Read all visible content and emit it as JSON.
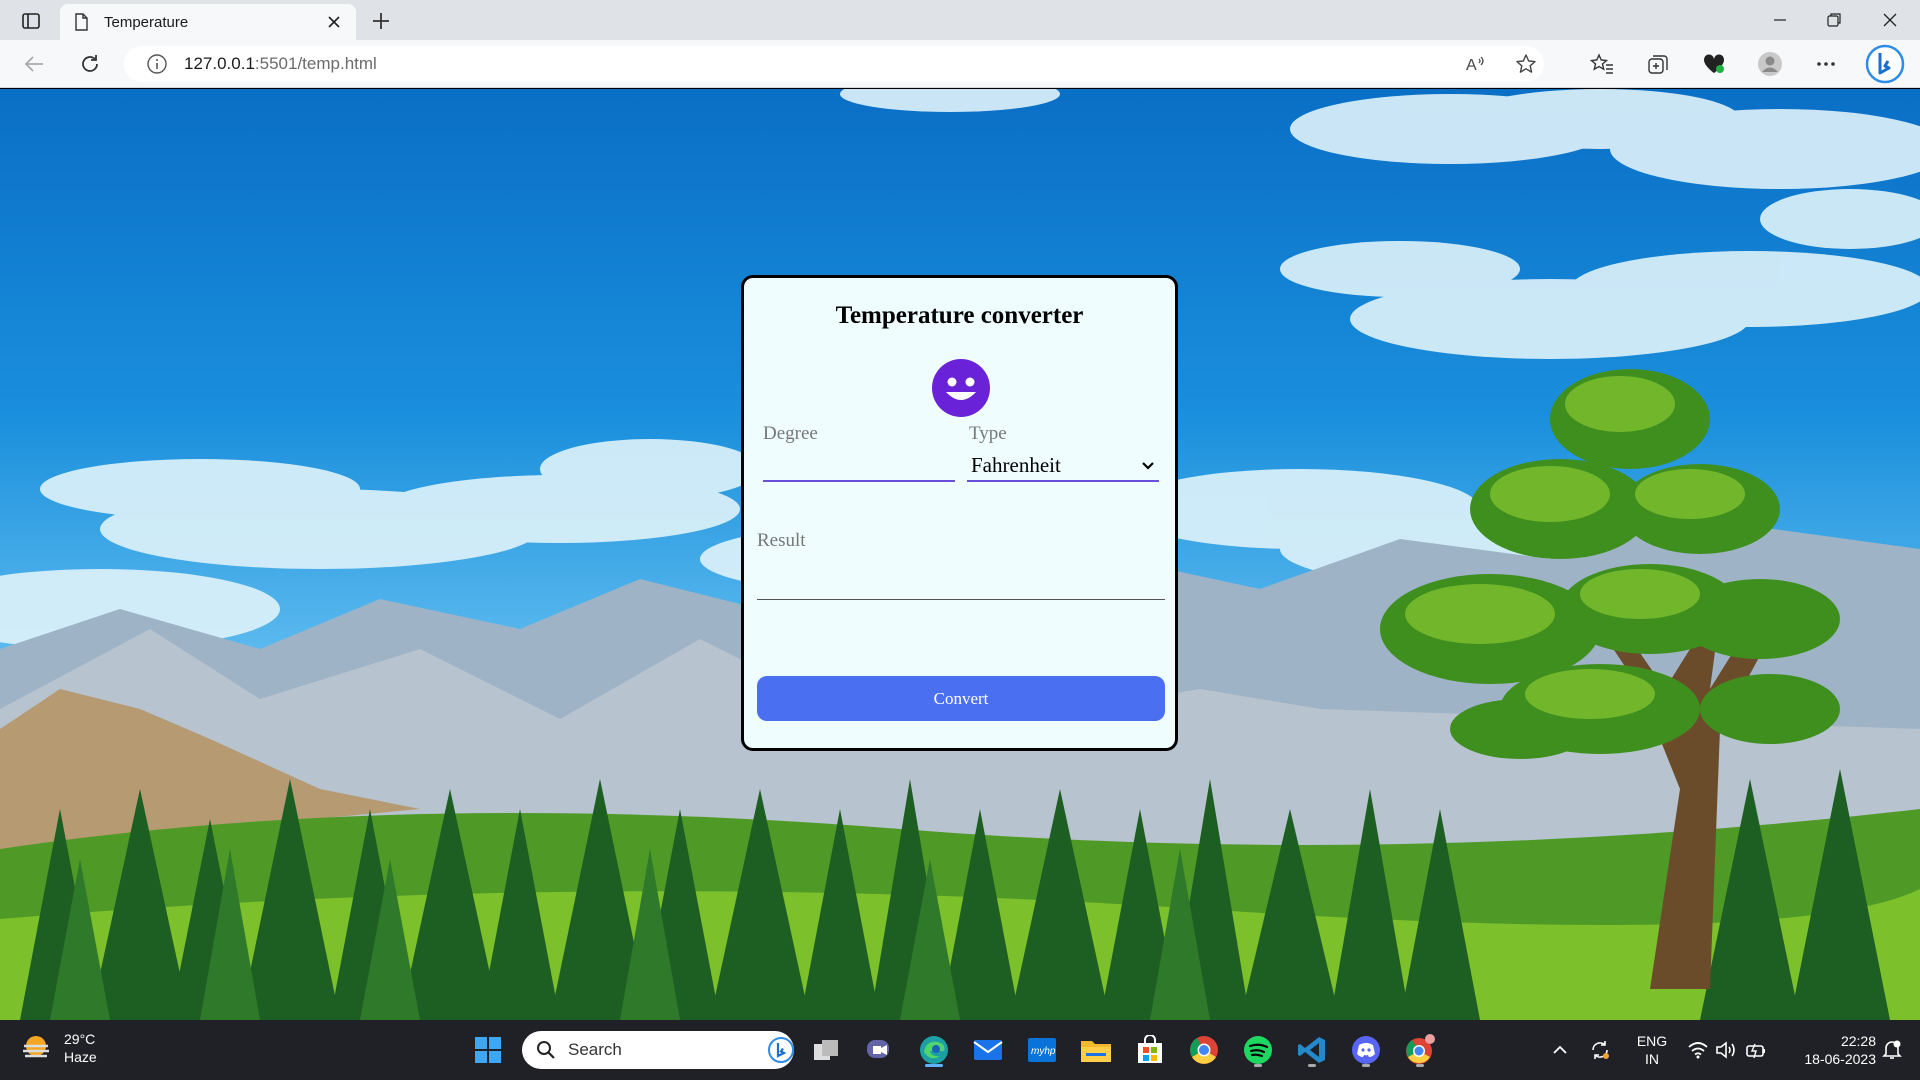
{
  "browser": {
    "tab_title": "Temperature",
    "url_host": "127.0.0.1",
    "url_path": ":5501/temp.html",
    "read_aloud_label": "Ȃ"
  },
  "card": {
    "title": "Temperature converter",
    "degree_label": "Degree",
    "degree_value": "",
    "type_label": "Type",
    "type_value": "Fahrenheit",
    "result_label": "Result",
    "result_value": "",
    "convert_label": "Convert",
    "accent": "#4a6ff0",
    "smiley_color": "#6a22d9"
  },
  "taskbar": {
    "weather_temp": "29°C",
    "weather_desc": "Haze",
    "search_label": "Search",
    "lang_top": "ENG",
    "lang_bottom": "IN",
    "time": "22:28",
    "date": "18-06-2023"
  }
}
